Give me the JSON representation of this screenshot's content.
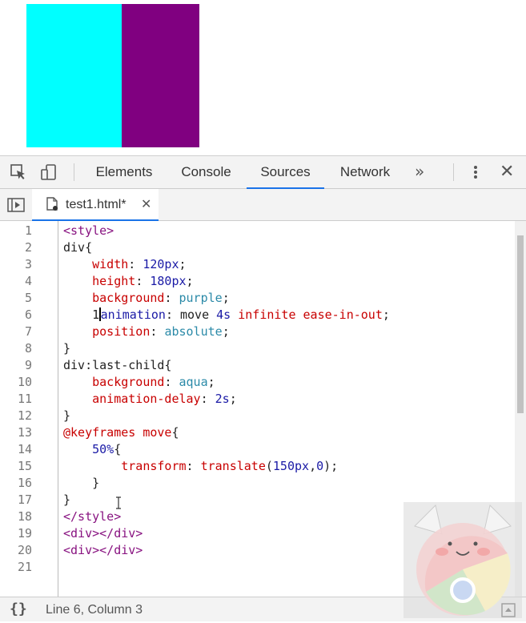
{
  "preview": {
    "box_colors": [
      "#00ffff",
      "#800080"
    ]
  },
  "toolbar": {
    "tabs": [
      {
        "label": "Elements"
      },
      {
        "label": "Console"
      },
      {
        "label": "Sources"
      },
      {
        "label": "Network"
      }
    ],
    "active_tab": "Sources",
    "overflow_label": "»",
    "close_label": "✕"
  },
  "filebar": {
    "file_name": "test1.html*",
    "close_label": "✕"
  },
  "editor": {
    "line_numbers": [
      "1",
      "2",
      "3",
      "4",
      "5",
      "6",
      "7",
      "8",
      "9",
      "10",
      "11",
      "12",
      "13",
      "14",
      "15",
      "16",
      "17",
      "18",
      "19",
      "20",
      "21"
    ],
    "code": [
      {
        "a": "<style>"
      },
      {
        "a": "div{"
      },
      {
        "a": "    ",
        "p": "width",
        "s": ": ",
        "v": "120px",
        "e": ";"
      },
      {
        "a": "    ",
        "p": "height",
        "s": ": ",
        "v": "180px",
        "e": ";"
      },
      {
        "a": "    ",
        "p": "background",
        "s": ": ",
        "k": "purple",
        "e": ";"
      },
      {
        "a": "    1",
        "p": "animation",
        "s": ": move ",
        "v": "4s",
        "x": " infinite ease-in-out",
        "e": ";"
      },
      {
        "a": "    ",
        "p": "position",
        "s": ": ",
        "k": "absolute",
        "e": ";"
      },
      {
        "a": "}"
      },
      {
        "a": "div:last-child{"
      },
      {
        "a": "    ",
        "p": "background",
        "s": ": ",
        "k": "aqua",
        "e": ";"
      },
      {
        "a": "    ",
        "p": "animation-delay",
        "s": ": ",
        "v": "2s",
        "e": ";"
      },
      {
        "a": "}"
      },
      {
        "a": "@keyframes move",
        "e": "{"
      },
      {
        "a": "    ",
        "v": "50%",
        "e": "{"
      },
      {
        "a": "        ",
        "p": "transform",
        "s": ": ",
        "x": "translate",
        "s2": "(",
        "v": "150px",
        "s3": ",",
        "v2": "0",
        "e": ");"
      },
      {
        "a": "    }"
      },
      {
        "a": "}"
      },
      {
        "a": "</style>"
      },
      {
        "a": "<div></div>"
      },
      {
        "a": "<div></div>"
      },
      {
        "a": ""
      }
    ]
  },
  "status": {
    "format_label": "{}",
    "cursor_position": "Line 6, Column 3"
  },
  "colors": {
    "accent": "#1a73e8",
    "tag": "#881280",
    "property": "#c80000",
    "number": "#1a1aa6",
    "keyword": "#2b8aa8"
  }
}
